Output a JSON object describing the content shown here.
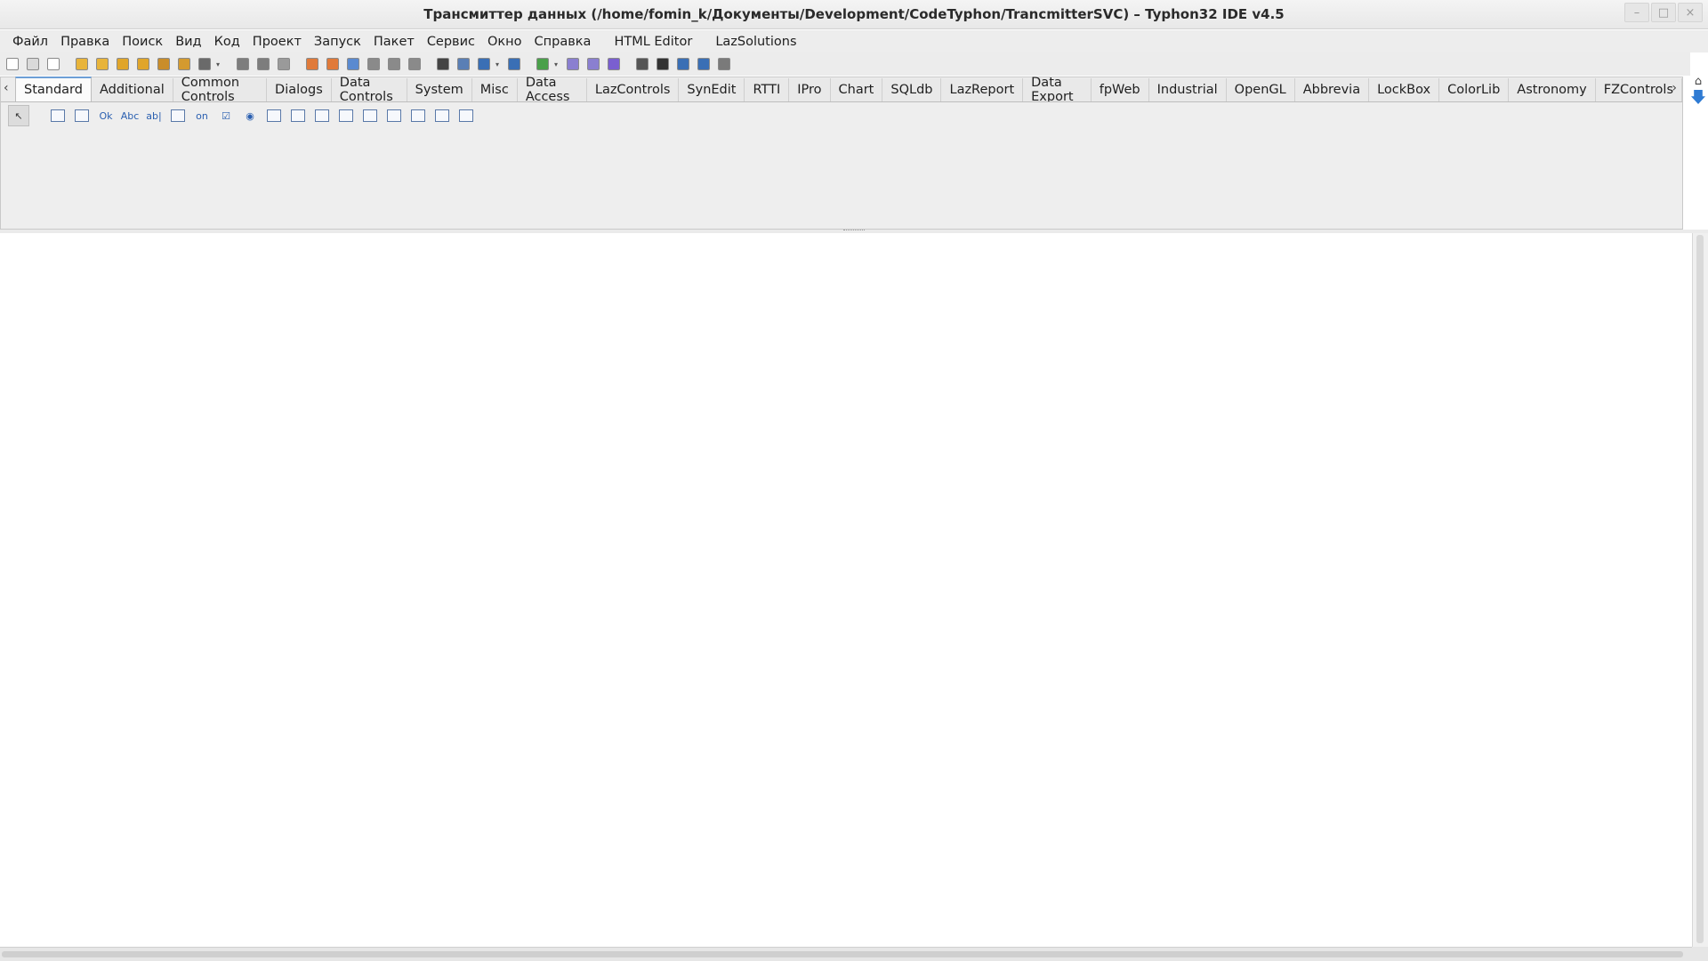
{
  "window": {
    "title": "Трансмиттер данных (/home/fomin_k/Документы/Development/CodeTyphon/TrancmitterSVC) – Typhon32 IDE v4.5",
    "minimize": "–",
    "maximize": "□",
    "close": "×"
  },
  "menu": {
    "items": [
      "Файл",
      "Правка",
      "Поиск",
      "Вид",
      "Код",
      "Проект",
      "Запуск",
      "Пакет",
      "Сервис",
      "Окно",
      "Справка"
    ],
    "extra": [
      "HTML Editor",
      "LazSolutions"
    ]
  },
  "toolbar": {
    "icons": [
      {
        "name": "new-unit-icon",
        "color": "#ffffff"
      },
      {
        "name": "new-form-icon",
        "color": "#d9d9d9"
      },
      {
        "name": "new-window-icon",
        "color": "#ffffff"
      },
      {
        "name": "open-icon",
        "color": "#e8b43a"
      },
      {
        "name": "open-recent-icon",
        "color": "#e8b43a"
      },
      {
        "name": "open-package-icon",
        "color": "#e0a52a"
      },
      {
        "name": "open-project-icon",
        "color": "#e0a52a"
      },
      {
        "name": "find-icon",
        "color": "#c98d2a"
      },
      {
        "name": "build-icon",
        "color": "#d49a2f"
      },
      {
        "name": "add-icon",
        "color": "#6a6a6a"
      },
      {
        "name": "save-icon",
        "color": "#7d7d7d"
      },
      {
        "name": "save-all-icon",
        "color": "#7d7d7d"
      },
      {
        "name": "close-icon",
        "color": "#9a9a9a"
      },
      {
        "name": "edit-icon",
        "color": "#e07a3a"
      },
      {
        "name": "component-icon",
        "color": "#e07a3a"
      },
      {
        "name": "inspector-icon",
        "color": "#5a8ad0"
      },
      {
        "name": "copy-icon",
        "color": "#8a8a8a"
      },
      {
        "name": "form-icon",
        "color": "#8a8a8a"
      },
      {
        "name": "toggle-icon",
        "color": "#8a8a8a"
      },
      {
        "name": "binoculars-icon",
        "color": "#444444"
      },
      {
        "name": "tools-icon",
        "color": "#5a7fb5"
      },
      {
        "name": "compile-icon",
        "color": "#3a6fb5"
      },
      {
        "name": "build-project-icon",
        "color": "#3a6fb5"
      },
      {
        "name": "package-icon",
        "color": "#4aa04a"
      },
      {
        "name": "debug-icon",
        "color": "#8a7fd0"
      },
      {
        "name": "step-icon",
        "color": "#8a7fd0"
      },
      {
        "name": "run-icon",
        "color": "#7a5fd0"
      },
      {
        "name": "pause-icon",
        "color": "#555555"
      },
      {
        "name": "stop-icon",
        "color": "#333333"
      },
      {
        "name": "step-into-icon",
        "color": "#3a6fb5"
      },
      {
        "name": "step-over-icon",
        "color": "#3a6fb5"
      },
      {
        "name": "step-out-icon",
        "color": "#7a7a7a"
      }
    ]
  },
  "palette": {
    "tabs": [
      "Standard",
      "Additional",
      "Common Controls",
      "Dialogs",
      "Data Controls",
      "System",
      "Misc",
      "Data Access",
      "LazControls",
      "SynEdit",
      "RTTI",
      "IPro",
      "Chart",
      "SQLdb",
      "LazReport",
      "Data Export",
      "fpWeb",
      "Industrial",
      "OpenGL",
      "Abbrevia",
      "LockBox",
      "ColorLib",
      "Astronomy",
      "FZControls"
    ],
    "active_tab": "Standard",
    "left_arrow": "‹",
    "right_arrow": "›",
    "components": [
      {
        "name": "pointer-tool-icon",
        "label": "↖"
      },
      {
        "name": "mainmenu-icon",
        "label": ""
      },
      {
        "name": "popupmenu-icon",
        "label": ""
      },
      {
        "name": "button-icon",
        "label": "Ok"
      },
      {
        "name": "label-icon",
        "label": "Abc"
      },
      {
        "name": "edit-icon",
        "label": "ab|"
      },
      {
        "name": "memo-icon",
        "label": ""
      },
      {
        "name": "togglebox-icon",
        "label": "on"
      },
      {
        "name": "checkbox-icon",
        "label": "☑"
      },
      {
        "name": "radiobutton-icon",
        "label": "◉"
      },
      {
        "name": "listbox-icon",
        "label": ""
      },
      {
        "name": "combobox-icon",
        "label": ""
      },
      {
        "name": "scrollbar-icon",
        "label": ""
      },
      {
        "name": "groupbox-icon",
        "label": ""
      },
      {
        "name": "radiogroup-icon",
        "label": ""
      },
      {
        "name": "checkgroup-icon",
        "label": ""
      },
      {
        "name": "panel-icon",
        "label": ""
      },
      {
        "name": "frame-icon",
        "label": ""
      },
      {
        "name": "actionlist-icon",
        "label": ""
      }
    ]
  },
  "side": {
    "top_glyph": "⌂"
  }
}
